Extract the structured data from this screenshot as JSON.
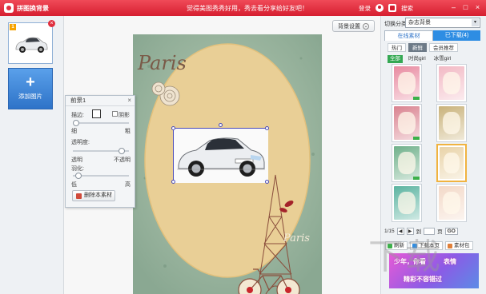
{
  "titlebar": {
    "app_title": "拼图换背景",
    "slogan": "觉得美图秀秀好用，秀去看分享给好友吧！",
    "login": "登录",
    "search": "搜索",
    "win_min": "–",
    "win_max": "□",
    "win_close": "×"
  },
  "left_panel": {
    "thumb_number": "1",
    "thumb_delete": "×",
    "add_plus": "+",
    "add_label": "添加图片"
  },
  "toolbar": {
    "bg_settings": "背景设置",
    "bg_chevron": "⌄"
  },
  "template": {
    "script_text_top": "Paris",
    "script_text_bottom": "Paris"
  },
  "props": {
    "title": "前景1",
    "close": "×",
    "border_label": "描边:",
    "shadow_label": "阴影",
    "border_thin": "细",
    "border_thick": "粗",
    "opacity_label": "透明度:",
    "opacity_left": "透明",
    "opacity_right": "不透明",
    "feather_label": "羽化:",
    "feather_low": "低",
    "feather_high": "高",
    "delete_label": "删除本素材",
    "opacity_value": 0.92,
    "feather_value": 0.05,
    "border_value": 0.0
  },
  "right_panel": {
    "switch_label": "切换分类",
    "category": "杂志背景",
    "dropdown": "▾",
    "tabs": [
      {
        "label": "在线素材"
      },
      {
        "label": "已下载(4)"
      }
    ],
    "subtabs": [
      {
        "label": "热门"
      },
      {
        "label": "新鲜"
      },
      {
        "label": "会员推荐"
      }
    ],
    "styles": [
      {
        "label": "全部"
      },
      {
        "label": "时尚girl"
      },
      {
        "label": "冰雪girl"
      }
    ],
    "tiles": [
      {
        "color": "#e88aa0"
      },
      {
        "color": "#f2b9c4"
      },
      {
        "color": "#d9828f"
      },
      {
        "color": "#c9b27a"
      },
      {
        "color": "#6fb08a"
      },
      {
        "color": "#e9d3a8"
      },
      {
        "color": "#5bb3a0"
      },
      {
        "color": "#f3d9c8"
      }
    ],
    "pager": {
      "page": "1/15",
      "prev": "◀",
      "next": "▶",
      "goto": "到",
      "page_unit": "页",
      "go": "GO"
    },
    "actions": [
      {
        "label": "刷新",
        "color": "#3cb04a"
      },
      {
        "label": "下载本页",
        "color": "#2e8de3"
      },
      {
        "label": "素材包",
        "color": "#e0803a"
      }
    ],
    "promo_lines": [
      "少年，你看",
      "表情",
      "精彩不容错过"
    ]
  },
  "watermark": "下载"
}
